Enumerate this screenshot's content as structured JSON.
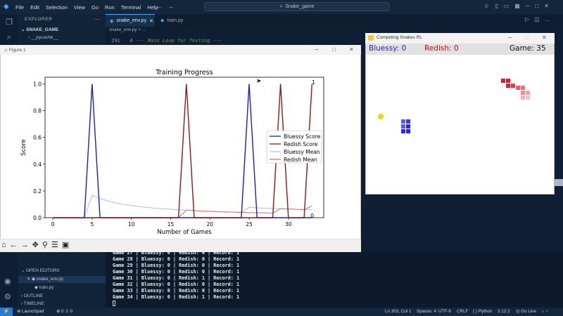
{
  "app": {
    "menu": [
      "File",
      "Edit",
      "Selection",
      "View",
      "Go",
      "Run",
      "Terminal",
      "Help"
    ],
    "command_center": "Snake_game"
  },
  "sidebar": {
    "title": "EXPLORER",
    "folder": "SNAKE_GAME",
    "items": [
      "__pycache__"
    ],
    "open_editors": "OPEN EDITORS",
    "open_files": [
      "snake_env.py",
      "train.py"
    ],
    "outline": "OUTLINE",
    "timeline": "TIMELINE"
  },
  "tabs": [
    {
      "label": "snake_env.py",
      "active": true
    },
    {
      "label": "train.py",
      "active": false
    }
  ],
  "breadcrumb": "snake_env.py > ...",
  "code": {
    "line_number": "291",
    "text": "# --- Main Loop for Testing ---"
  },
  "terminal": {
    "lines": [
      "Game 27 | Bluessy: 0 | Redish: 0 | Record: 1",
      "Game 28 | Bluessy: 0 | Redish: 0 | Record: 1",
      "Game 29 | Bluessy: 0 | Redish: 0 | Record: 1",
      "Game 30 | Bluessy: 0 | Redish: 0 | Record: 1",
      "Game 31 | Bluessy: 0 | Redish: 1 | Record: 1",
      "Game 32 | Bluessy: 0 | Redish: 0 | Record: 1",
      "Game 33 | Bluessy: 0 | Redish: 0 | Record: 1",
      "Game 34 | Bluessy: 0 | Redish: 1 | Record: 1"
    ]
  },
  "statusbar": {
    "launchpad": "Launchpad",
    "problems": "0 ⚠ 0",
    "position": "Ln 303, Col 1",
    "spaces": "Spaces: 4",
    "encoding": "UTF-8",
    "eol": "CRLF",
    "language": "Python",
    "version": "3.12.2",
    "golive": "Go Live"
  },
  "figure": {
    "window_title": "Figure 1"
  },
  "snakes": {
    "window_title": "Competing Snakes RL",
    "blue_score": "Bluessy: 0",
    "red_score": "Redish: 0",
    "game": "Game: 35",
    "colors": {
      "blue": "#2a2ae8",
      "red": "#e01a2b",
      "red_light": "#f0a0aa",
      "food": "#f2d21d"
    }
  },
  "chart_data": {
    "type": "line",
    "title": "Training Progress",
    "xlabel": "Number of Games",
    "ylabel": "Score",
    "xlim": [
      -1,
      34.5
    ],
    "ylim": [
      0,
      1.05
    ],
    "xticks": [
      0,
      5,
      10,
      15,
      20,
      25,
      30
    ],
    "yticks": [
      0.0,
      0.2,
      0.4,
      0.6,
      0.8,
      1.0
    ],
    "grid": false,
    "legend_position": "center-right",
    "end_labels": [
      "1",
      "0"
    ],
    "series": [
      {
        "name": "Bluessy Score",
        "color": "#1f1fb4",
        "x": [
          0,
          1,
          2,
          3,
          4,
          5,
          6,
          7,
          8,
          9,
          10,
          11,
          12,
          13,
          14,
          15,
          16,
          17,
          18,
          19,
          20,
          21,
          22,
          23,
          24,
          25,
          26,
          27,
          28,
          29,
          30,
          31,
          32,
          33
        ],
        "y": [
          0,
          0,
          0,
          0,
          0,
          1,
          0,
          0,
          0,
          0,
          0,
          0,
          0,
          0,
          0,
          0,
          0,
          0,
          0,
          0,
          0,
          0,
          0,
          0,
          0,
          1,
          0,
          0,
          0,
          0,
          0,
          0,
          0,
          0
        ]
      },
      {
        "name": "Redish Score",
        "color": "#8b1a1a",
        "x": [
          0,
          1,
          2,
          3,
          4,
          5,
          6,
          7,
          8,
          9,
          10,
          11,
          12,
          13,
          14,
          15,
          16,
          17,
          18,
          19,
          20,
          21,
          22,
          23,
          24,
          25,
          26,
          27,
          28,
          29,
          30,
          31,
          32,
          33
        ],
        "y": [
          0,
          0,
          0,
          0,
          0,
          0,
          0,
          0,
          0,
          0,
          0,
          0,
          0,
          0,
          0,
          0,
          0,
          1,
          0,
          0,
          0,
          0,
          0,
          0,
          0,
          0,
          0,
          0,
          0,
          1,
          0,
          0,
          0,
          1
        ]
      },
      {
        "name": "Bluessy Mean",
        "color": "#a9c8e8",
        "x": [
          4,
          5,
          6,
          7,
          8,
          9,
          10,
          11,
          12,
          13,
          14,
          15,
          16,
          17,
          18,
          19,
          20,
          21,
          22,
          23,
          24,
          25,
          26,
          27,
          28,
          29,
          30,
          31,
          32,
          33
        ],
        "y": [
          0,
          0.167,
          0.143,
          0.125,
          0.111,
          0.1,
          0.091,
          0.083,
          0.077,
          0.071,
          0.067,
          0.063,
          0.059,
          0.056,
          0.053,
          0.05,
          0.048,
          0.045,
          0.043,
          0.042,
          0.04,
          0.077,
          0.074,
          0.071,
          0.069,
          0.067,
          0.065,
          0.063,
          0.061,
          0.059
        ]
      },
      {
        "name": "Redish Mean",
        "color": "#e8706a",
        "x": [
          16,
          17,
          18,
          19,
          20,
          21,
          22,
          23,
          24,
          25,
          26,
          27,
          28,
          29,
          30,
          31,
          32,
          33
        ],
        "y": [
          0,
          0.056,
          0.053,
          0.05,
          0.048,
          0.045,
          0.043,
          0.042,
          0.04,
          0.038,
          0.037,
          0.036,
          0.034,
          0.067,
          0.065,
          0.063,
          0.061,
          0.088
        ]
      }
    ]
  }
}
